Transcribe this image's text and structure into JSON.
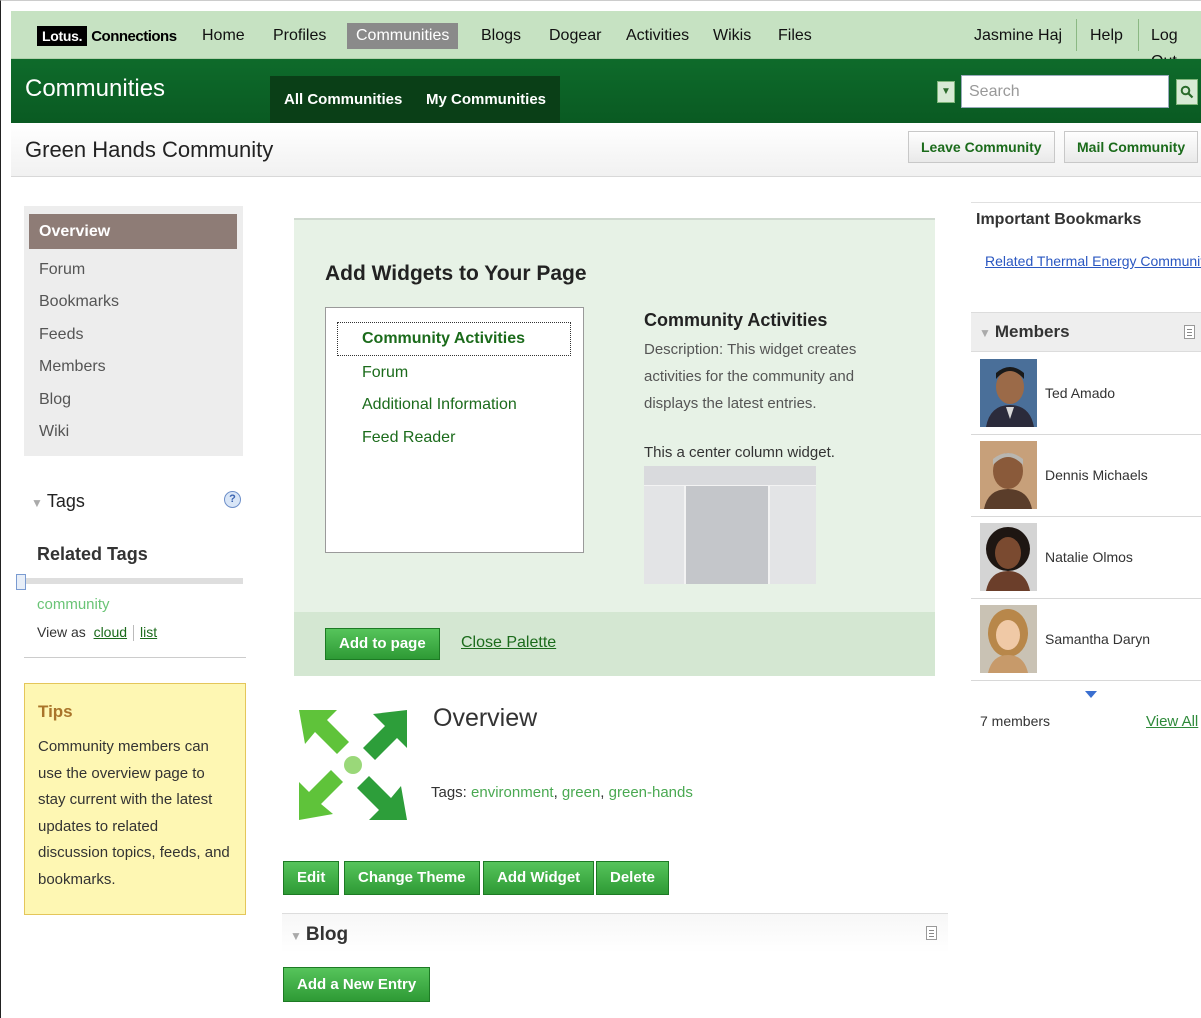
{
  "app": {
    "logo_brand": "Lotus.",
    "logo_product": "Connections"
  },
  "topnav": {
    "items": [
      "Home",
      "Profiles",
      "Communities",
      "Blogs",
      "Dogear",
      "Activities",
      "Wikis",
      "Files"
    ],
    "active": "Communities",
    "user": "Jasmine Haj",
    "help": "Help",
    "logout": "Log Out"
  },
  "banner": {
    "title": "Communities",
    "tabs": [
      "All Communities",
      "My Communities"
    ],
    "search_placeholder": "Search"
  },
  "community": {
    "name": "Green Hands Community",
    "actions": [
      "Leave Community",
      "Mail Community"
    ]
  },
  "leftnav": {
    "items": [
      "Overview",
      "Forum",
      "Bookmarks",
      "Feeds",
      "Members",
      "Blog",
      "Wiki"
    ],
    "active": "Overview"
  },
  "tags": {
    "title": "Tags",
    "related_title": "Related Tags",
    "items": [
      "community"
    ],
    "view_as": "View as",
    "view_cloud": "cloud",
    "view_list": "list"
  },
  "tips": {
    "title": "Tips",
    "body": "Community members can use the overview page to stay current with the latest updates to related discussion topics, feeds, and bookmarks."
  },
  "palette": {
    "title": "Add Widgets to Your Page",
    "widgets": [
      "Community Activities",
      "Forum",
      "Additional Information",
      "Feed Reader"
    ],
    "selected": "Community Activities",
    "detail_title": "Community Activities",
    "detail_description": "Description: This widget creates activities for the community and displays the latest entries.",
    "detail_position": "This a center column widget.",
    "add_button": "Add to page",
    "close_link": "Close Palette"
  },
  "overview": {
    "title": "Overview",
    "tags_label": "Tags:",
    "tags": [
      "environment",
      "green",
      "green-hands"
    ],
    "buttons": [
      "Edit",
      "Change Theme",
      "Add Widget",
      "Delete"
    ]
  },
  "blog": {
    "title": "Blog",
    "new_entry_button": "Add a New Entry"
  },
  "bookmarks": {
    "title": "Important Bookmarks",
    "links": [
      "Related Thermal Energy Community"
    ]
  },
  "members": {
    "title": "Members",
    "list": [
      "Ted Amado",
      "Dennis Michaels",
      "Natalie Olmos",
      "Samantha Daryn"
    ],
    "count": "7 members",
    "view_all": "View All"
  },
  "colors": {
    "nav_bg": "#c6e2c2",
    "banner_green": "#0e6b2b",
    "button_green": "#2e9a35",
    "link_green": "#1b6b1b",
    "tips_bg": "#fef7b3"
  }
}
